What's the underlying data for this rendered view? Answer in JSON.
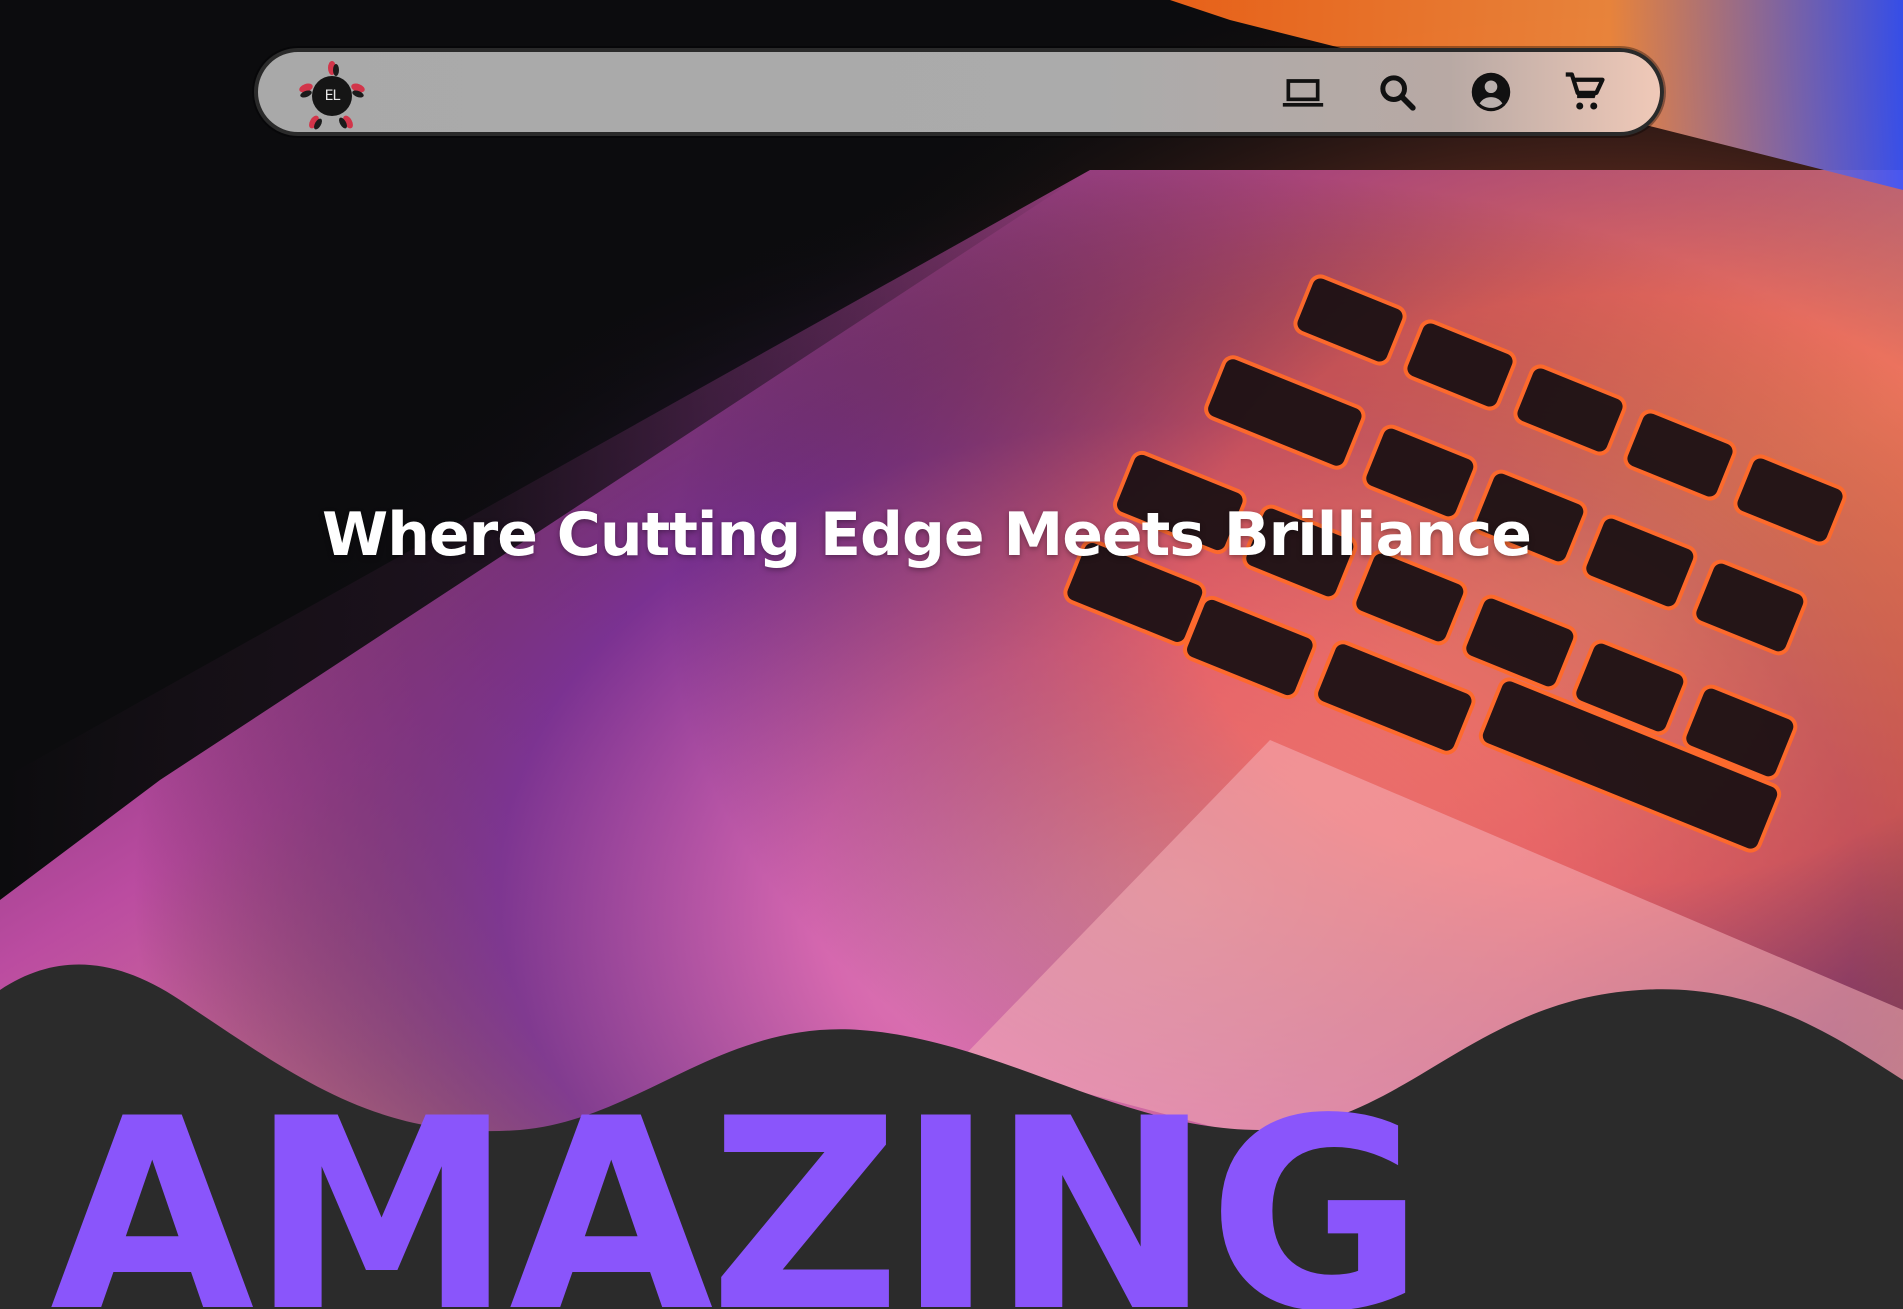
{
  "navbar": {
    "logo_text": "EL",
    "icons": [
      "laptop-icon",
      "search-icon",
      "account-icon",
      "cart-icon"
    ]
  },
  "hero": {
    "headline": "Where Cutting Edge Meets Brilliance",
    "big_word": "AMAZING"
  },
  "colors": {
    "accent": "#8a55fb",
    "wave": "#2b2b2b",
    "navbar": "#ababab"
  }
}
